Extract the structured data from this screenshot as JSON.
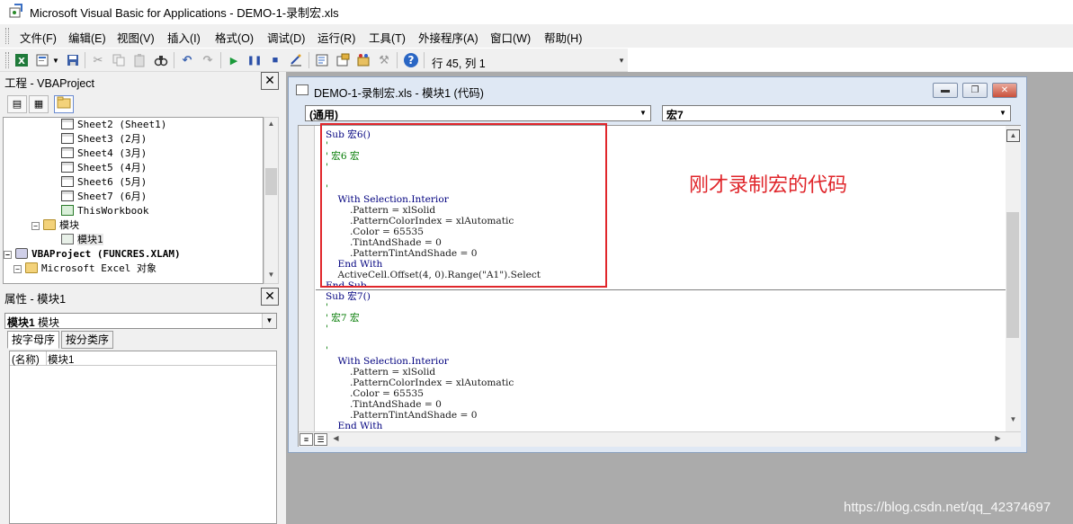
{
  "window": {
    "title": "Microsoft Visual Basic for Applications - DEMO-1-录制宏.xls",
    "app_icon": "vba-app-icon"
  },
  "menu": [
    "文件(F)",
    "编辑(E)",
    "视图(V)",
    "插入(I)",
    "格式(O)",
    "调试(D)",
    "运行(R)",
    "工具(T)",
    "外接程序(A)",
    "窗口(W)",
    "帮助(H)"
  ],
  "toolbar": {
    "icons": [
      "excel-icon",
      "insert-module-icon",
      "dropdown-icon",
      "save-icon",
      "cut-icon",
      "copy-icon",
      "paste-icon",
      "find-icon",
      "undo-icon",
      "redo-icon",
      "run-icon",
      "break-icon",
      "reset-icon",
      "design-mode-icon",
      "project-explorer-icon",
      "properties-icon",
      "object-browser-icon",
      "toolbox-icon",
      "help-icon"
    ],
    "position": "行 45, 列 1"
  },
  "project_panel": {
    "title": "工程 - VBAProject",
    "tree": [
      {
        "label": "Sheet2 (Sheet1)",
        "type": "sheet",
        "level": 3
      },
      {
        "label": "Sheet3 (2月)",
        "type": "sheet",
        "level": 3
      },
      {
        "label": "Sheet4 (3月)",
        "type": "sheet",
        "level": 3
      },
      {
        "label": "Sheet5 (4月)",
        "type": "sheet",
        "level": 3
      },
      {
        "label": "Sheet6 (5月)",
        "type": "sheet",
        "level": 3
      },
      {
        "label": "Sheet7 (6月)",
        "type": "sheet",
        "level": 3
      },
      {
        "label": "ThisWorkbook",
        "type": "book",
        "level": 3
      },
      {
        "label": "模块",
        "type": "folder",
        "level": 2,
        "expander": "−"
      },
      {
        "label": "模块1",
        "type": "module",
        "level": 3,
        "selected": true
      },
      {
        "label": "VBAProject (FUNCRES.XLAM)",
        "type": "project",
        "level": 0,
        "expander": "−",
        "bold": true
      },
      {
        "label": "Microsoft Excel 对象",
        "type": "folder",
        "level": 1,
        "expander": "−"
      }
    ]
  },
  "properties_panel": {
    "title": "属性 - 模块1",
    "object_name": "模块1",
    "object_type": "模块",
    "tabs": [
      "按字母序",
      "按分类序"
    ],
    "rows": [
      {
        "key": "(名称)",
        "value": "模块1"
      }
    ]
  },
  "code_window": {
    "title": "DEMO-1-录制宏.xls - 模块1 (代码)",
    "object_combo": "(通用)",
    "proc_combo": "宏7",
    "top_pane": [
      {
        "text": "Sub 宏6()",
        "style": "kw"
      },
      {
        "text": "'",
        "style": "cm"
      },
      {
        "text": "' 宏6 宏",
        "style": "cm"
      },
      {
        "text": "'",
        "style": "cm"
      },
      {
        "text": "",
        "style": ""
      },
      {
        "text": "'",
        "style": "cm"
      },
      {
        "text": "    With Selection.Interior",
        "style": "kw"
      },
      {
        "text": "        .Pattern = xlSolid",
        "style": ""
      },
      {
        "text": "        .PatternColorIndex = xlAutomatic",
        "style": ""
      },
      {
        "text": "        .Color = 65535",
        "style": ""
      },
      {
        "text": "        .TintAndShade = 0",
        "style": ""
      },
      {
        "text": "        .PatternTintAndShade = 0",
        "style": ""
      },
      {
        "text": "    End With",
        "style": "kw"
      },
      {
        "text": "    ActiveCell.Offset(4, 0).Range(\"A1\").Select",
        "style": ""
      },
      {
        "text": "End Sub",
        "style": "kw"
      }
    ],
    "bottom_pane": [
      {
        "text": "Sub 宏7()",
        "style": "kw"
      },
      {
        "text": "'",
        "style": "cm"
      },
      {
        "text": "' 宏7 宏",
        "style": "cm"
      },
      {
        "text": "'",
        "style": "cm"
      },
      {
        "text": "",
        "style": ""
      },
      {
        "text": "'",
        "style": "cm"
      },
      {
        "text": "    With Selection.Interior",
        "style": "kw"
      },
      {
        "text": "        .Pattern = xlSolid",
        "style": ""
      },
      {
        "text": "        .PatternColorIndex = xlAutomatic",
        "style": ""
      },
      {
        "text": "        .Color = 65535",
        "style": ""
      },
      {
        "text": "        .TintAndShade = 0",
        "style": ""
      },
      {
        "text": "        .PatternTintAndShade = 0",
        "style": ""
      },
      {
        "text": "    End With",
        "style": "kw"
      }
    ]
  },
  "annotation": "刚才录制宏的代码",
  "watermark": "https://blog.csdn.net/qq_42374697",
  "colors": {
    "annotation": "#e0262b",
    "keyword": "#00007f",
    "comment": "#007a00"
  }
}
